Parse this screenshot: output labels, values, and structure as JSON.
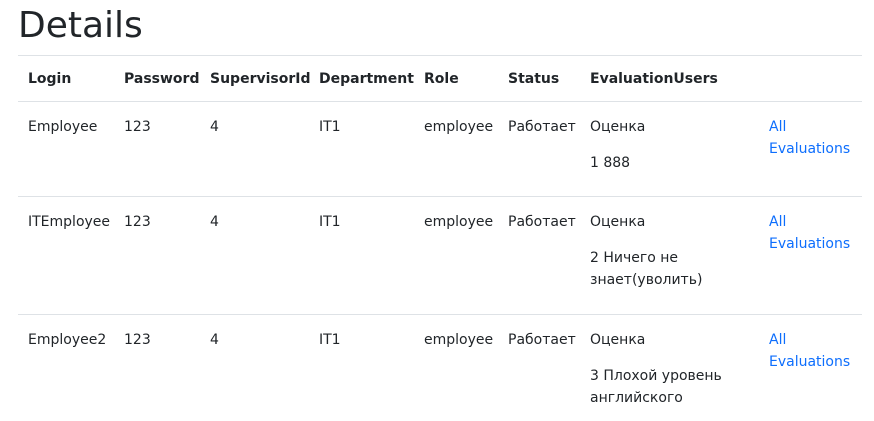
{
  "page": {
    "title": "Details"
  },
  "table": {
    "headers": [
      "Login",
      "Password",
      "SupervisorId",
      "Department",
      "Role",
      "Status",
      "EvaluationUsers",
      ""
    ],
    "rows": [
      {
        "login": "Employee",
        "password": "123",
        "supervisor_id": "4",
        "department": "IT1",
        "role": "employee",
        "status": "Работает",
        "evaluation_label": "Оценка",
        "evaluation_value": "1 888",
        "link_label": "All Evaluations"
      },
      {
        "login": "ITEmployee",
        "password": "123",
        "supervisor_id": "4",
        "department": "IT1",
        "role": "employee",
        "status": "Работает",
        "evaluation_label": "Оценка",
        "evaluation_value": "2 Ничего не знает(уволить)",
        "link_label": "All Evaluations"
      },
      {
        "login": "Employee2",
        "password": "123",
        "supervisor_id": "4",
        "department": "IT1",
        "role": "employee",
        "status": "Работает",
        "evaluation_label": "Оценка",
        "evaluation_value": "3 Плохой уровень английского",
        "link_label": "All Evaluations"
      }
    ]
  },
  "colors": {
    "text": "#212529",
    "link": "#0d6efd",
    "border": "#dee2e6"
  }
}
